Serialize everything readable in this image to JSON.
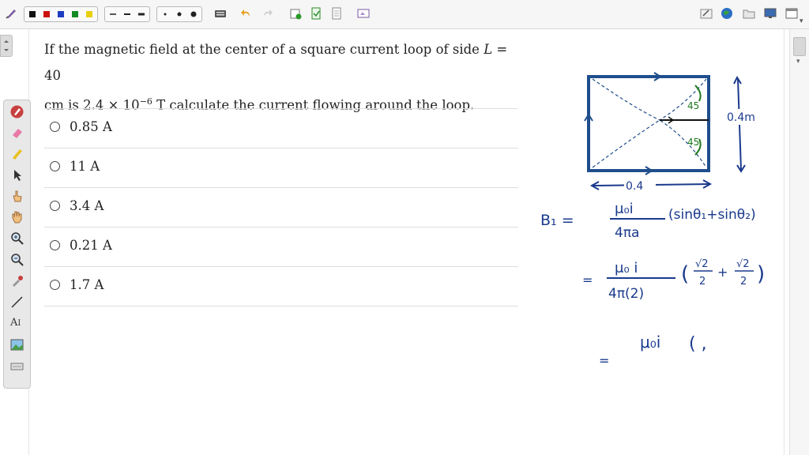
{
  "question": {
    "line1_prefix": "If the magnetic field at the center of a square current loop of side ",
    "line1_var": "L",
    "line1_suffix": " = 40",
    "line2_prefix": "cm is 2.4 × 10",
    "line2_exp": "−6",
    "line2_suffix": " T calculate the current flowing around the loop."
  },
  "options": [
    {
      "label": "0.85 A"
    },
    {
      "label": "11 A"
    },
    {
      "label": "3.4 A"
    },
    {
      "label": "0.21 A"
    },
    {
      "label": "1.7 A"
    }
  ],
  "handwriting": {
    "side_label": "0.4m",
    "bottom_label": "0.4",
    "angle_label": "45",
    "line1_lhs": "B₁ =",
    "line1_num": "μ₀i",
    "line1_den": "4πa",
    "line1_paren": "(sinθ₁+sinθ₂)",
    "line2_eq": "=",
    "line2_num": "μ₀ i",
    "line2_den": "4π(2)",
    "line2_frac_a_num": "√2",
    "line2_frac_a_den": "2",
    "line2_plus": "+",
    "line2_frac_b_num": "√2",
    "line2_frac_b_den": "2",
    "line3_eq": "=",
    "line3_num": "μ₀i",
    "line3_paren": "( ,"
  },
  "colors": {
    "ink_blue": "#1a3a8c",
    "ink_green": "#1f7a1f",
    "square_blue": "#1f4e8c"
  }
}
